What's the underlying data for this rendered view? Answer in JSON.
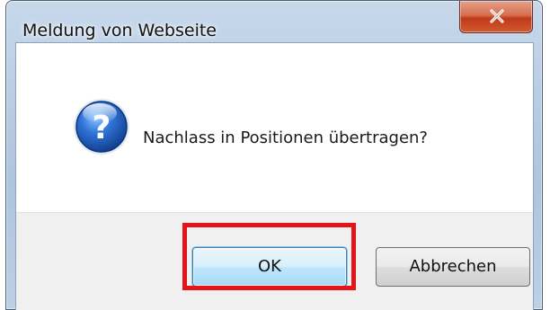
{
  "dialog": {
    "title": "Meldung von Webseite",
    "message": "Nachlass in Positionen übertragen?",
    "close_icon": "close-icon",
    "message_icon": "question-icon",
    "buttons": {
      "ok_label": "OK",
      "cancel_label": "Abbrechen"
    }
  },
  "highlight": {
    "target": "ok-button",
    "color": "#e3141a"
  },
  "colors": {
    "title_bar": "#b9cde3",
    "close_button": "#c2391a",
    "client_background": "#ffffff",
    "button_strip": "#f0f0f0",
    "question_icon": "#1f5bb3"
  }
}
